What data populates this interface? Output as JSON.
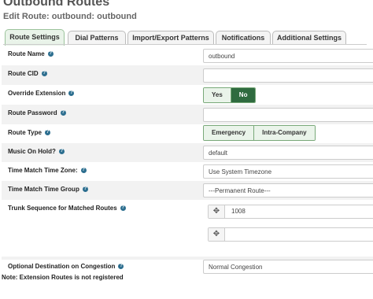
{
  "page": {
    "title": "Outbound Routes",
    "subtitle": "Edit Route: outbound: outbound"
  },
  "tabs": [
    {
      "label": "Route Settings"
    },
    {
      "label": "Dial Patterns"
    },
    {
      "label": "Import/Export Patterns"
    },
    {
      "label": "Notifications"
    },
    {
      "label": "Additional Settings"
    }
  ],
  "help_icon": "?",
  "fields": {
    "route_name": {
      "label": "Route Name",
      "value": "outbound"
    },
    "route_cid": {
      "label": "Route CID",
      "value": ""
    },
    "override_extension": {
      "label": "Override Extension",
      "options": [
        "Yes",
        "No"
      ],
      "selected": "No"
    },
    "route_password": {
      "label": "Route Password",
      "value": ""
    },
    "route_type": {
      "label": "Route Type",
      "options": [
        "Emergency",
        "Intra-Company"
      ]
    },
    "music_on_hold": {
      "label": "Music On Hold?",
      "value": "default"
    },
    "time_zone": {
      "label": "Time Match Time Zone:",
      "value": "Use System Timezone"
    },
    "time_group": {
      "label": "Time Match Time Group",
      "value": "---Permanent Route---"
    },
    "trunk_sequence": {
      "label": "Trunk Sequence for Matched Routes",
      "trunks": [
        "1008",
        ""
      ]
    },
    "congestion": {
      "label": "Optional Destination on Congestion",
      "value": "Normal Congestion"
    }
  },
  "drag_icon": "✥",
  "note": "Note: Extension Routes is not registered"
}
